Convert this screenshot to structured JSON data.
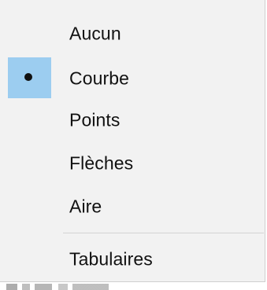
{
  "menu": {
    "items": [
      {
        "label": "Aucun",
        "selected": false
      },
      {
        "label": "Courbe",
        "selected": true
      },
      {
        "label": "Points",
        "selected": false
      },
      {
        "label": "Flèches",
        "selected": false
      },
      {
        "label": "Aire",
        "selected": false
      },
      {
        "label": "Tabulaires",
        "selected": false
      }
    ],
    "selection_color": "#9ccdf0"
  }
}
